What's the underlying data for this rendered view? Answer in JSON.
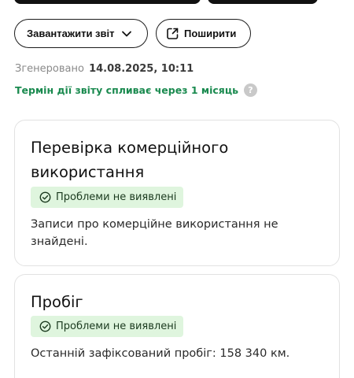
{
  "toolbar": {
    "download_label": "Завантажити звіт",
    "share_label": "Поширити"
  },
  "report": {
    "generated_label": "Згенеровано",
    "generated_value": "14.08.2025, 10:11",
    "expiry_text": "Термін дії звіту спливає через 1 місяць",
    "help_symbol": "?"
  },
  "checks": [
    {
      "title": "Перевірка комерційного використання",
      "status": "Проблеми не виявлені",
      "description": "Записи про комерційне використання не знайдені."
    },
    {
      "title": "Пробіг",
      "status": "Проблеми не виявлені",
      "description": "Останній зафіксований пробіг: 158 340 км."
    }
  ],
  "colors": {
    "accent_green": "#1a8a4f",
    "badge_bg": "#dff5de",
    "border": "#e2e2e2"
  },
  "icons": {
    "download_chevron": "chevron-down-icon",
    "share": "share-icon",
    "status": "check-circle-icon",
    "help": "question-icon"
  }
}
